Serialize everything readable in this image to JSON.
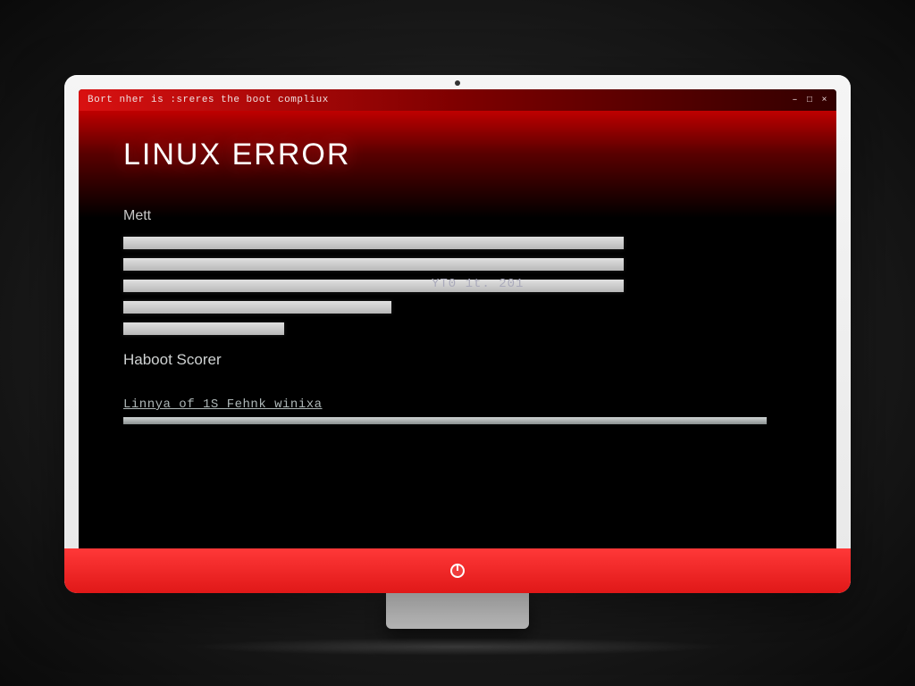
{
  "titlebar": {
    "text": "Bort nher is :sreres the boot compliux",
    "controls": {
      "min": "–",
      "max": "□",
      "close": "×"
    }
  },
  "main": {
    "title_left": "LINUX",
    "title_right": "ERROR",
    "label_meta": "Mett",
    "timestamp": "YT0 1t. 201",
    "label_boot": "Haboot Scorer",
    "link_text": "Linnya of 1S Fehnk winixa"
  }
}
